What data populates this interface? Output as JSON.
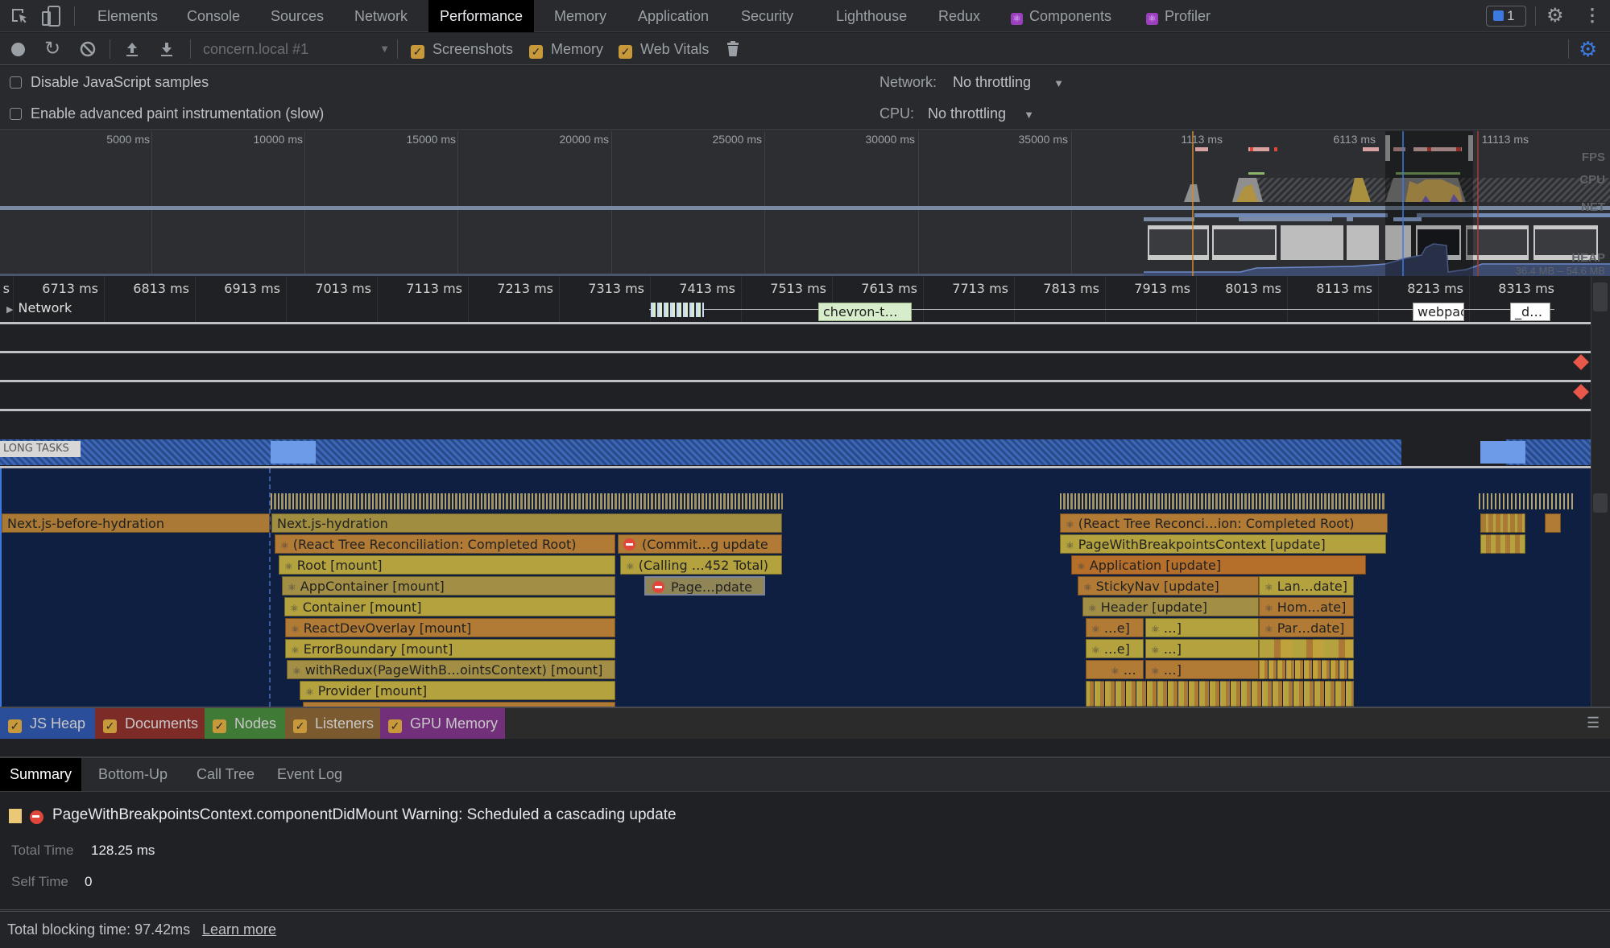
{
  "tabbar": {
    "tabs": [
      {
        "label": "Elements",
        "active": false
      },
      {
        "label": "Console",
        "active": false
      },
      {
        "label": "Sources",
        "active": false
      },
      {
        "label": "Network",
        "active": false
      },
      {
        "label": "Performance",
        "active": true
      },
      {
        "label": "Memory",
        "active": false
      },
      {
        "label": "Application",
        "active": false
      },
      {
        "label": "Security",
        "active": false
      },
      {
        "label": "Lighthouse",
        "active": false
      },
      {
        "label": "Redux",
        "active": false
      },
      {
        "label": "Components",
        "active": false,
        "icon": "react-icon"
      },
      {
        "label": "Profiler",
        "active": false,
        "icon": "react-icon"
      }
    ],
    "issues_count": "1"
  },
  "toolbar": {
    "profile_select": "concern.local #1",
    "checkboxes": [
      {
        "label": "Screenshots",
        "checked": true
      },
      {
        "label": "Memory",
        "checked": true
      },
      {
        "label": "Web Vitals",
        "checked": true
      }
    ]
  },
  "settings": {
    "disable_js_samples": "Disable JavaScript samples",
    "advanced_paint": "Enable advanced paint instrumentation (slow)",
    "network_label": "Network:",
    "network_value": "No throttling",
    "cpu_label": "CPU:",
    "cpu_value": "No throttling"
  },
  "overview": {
    "ticks": [
      "5000 ms",
      "10000 ms",
      "15000 ms",
      "20000 ms",
      "25000 ms",
      "30000 ms",
      "35000 ms",
      "1113 ms",
      "6113 ms",
      "11113 ms"
    ],
    "lanes": [
      "FPS",
      "CPU",
      "NET",
      "HEAP"
    ],
    "heap_range": "36.4 MB – 54.6 MB"
  },
  "detail": {
    "ticks": [
      "s",
      "6713 ms",
      "6813 ms",
      "6913 ms",
      "7013 ms",
      "7113 ms",
      "7213 ms",
      "7313 ms",
      "7413 ms",
      "7513 ms",
      "7613 ms",
      "7713 ms",
      "7813 ms",
      "7913 ms",
      "8013 ms",
      "8113 ms",
      "8213 ms",
      "8313 ms"
    ],
    "network_track": "Network",
    "network_requests": [
      "chevron-t…",
      "webpac",
      "_d…"
    ],
    "long_tasks": "LONG TASKS",
    "flames": {
      "before_hydration": "Next.js-before-hydration",
      "hydration": "Next.js-hydration",
      "reconciliation": "(React Tree Reconciliation: Completed Root)",
      "root": "Root [mount]",
      "app_container": "AppContainer [mount]",
      "container": "Container [mount]",
      "dev_overlay": "ReactDevOverlay [mount]",
      "error_boundary": "ErrorBoundary [mount]",
      "with_redux": "withRedux(PageWithB…ointsContext) [mount]",
      "provider": "Provider [mount]",
      "commit": "(Commit…g update",
      "calling": "(Calling …452 Total)",
      "page_update": "Page…pdate",
      "reconciliation2": "(React Tree Reconci…ion: Completed Root)",
      "page_breakpoints": "PageWithBreakpointsContext [update]",
      "application": "Application [update]",
      "sticky_nav": "StickyNav [update]",
      "lan": "Lan…date]",
      "header": "Header [update]",
      "hom": "Hom…ate]",
      "e1": "…e]",
      "b1": "…]",
      "par": "Par…date]",
      "e2": "…e]",
      "b2": "…]",
      "d1": "…",
      "d2": "…]"
    }
  },
  "counters": [
    {
      "label": "JS Heap",
      "color": "#2b4e9a"
    },
    {
      "label": "Documents",
      "color": "#7c2b27"
    },
    {
      "label": "Nodes",
      "color": "#3f7a36"
    },
    {
      "label": "Listeners",
      "color": "#7a5a2e"
    },
    {
      "label": "GPU Memory",
      "color": "#73307a"
    }
  ],
  "subtabs": [
    {
      "label": "Summary",
      "active": true
    },
    {
      "label": "Bottom-Up",
      "active": false
    },
    {
      "label": "Call Tree",
      "active": false
    },
    {
      "label": "Event Log",
      "active": false
    }
  ],
  "summary": {
    "title": "PageWithBreakpointsContext.componentDidMount Warning: Scheduled a cascading update",
    "total_time_label": "Total Time",
    "total_time_value": "128.25 ms",
    "self_time_label": "Self Time",
    "self_time_value": "0"
  },
  "footer": {
    "tbt": "Total blocking time: 97.42ms",
    "learn_more": "Learn more"
  }
}
